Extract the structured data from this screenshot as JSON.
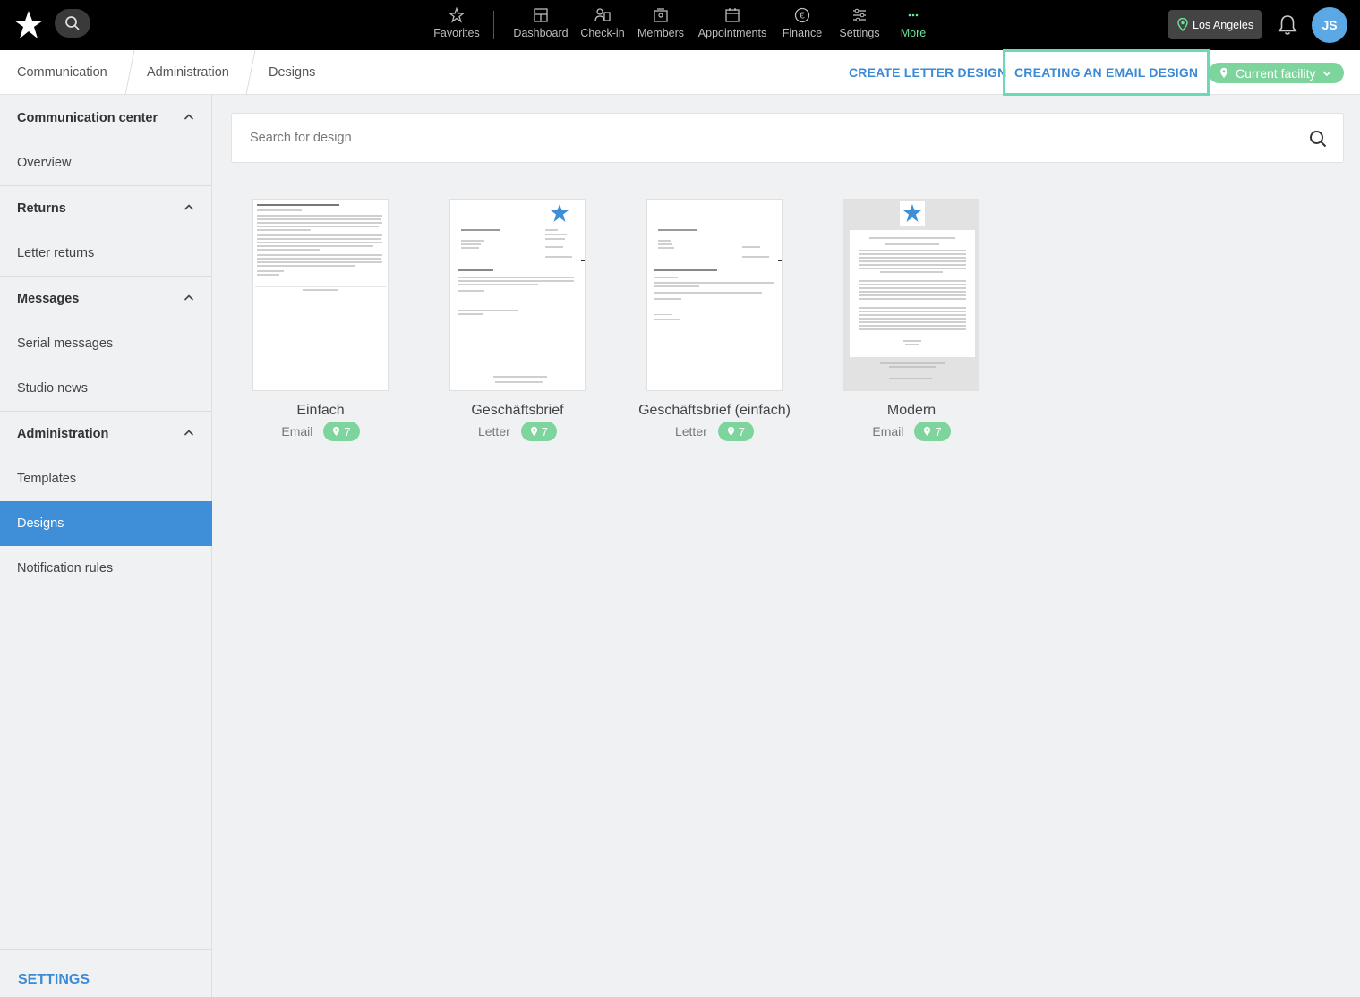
{
  "topbar": {
    "nav": [
      {
        "label": "Favorites",
        "icon": "star-icon"
      },
      {
        "label": "Dashboard",
        "icon": "dashboard-icon"
      },
      {
        "label": "Check-in",
        "icon": "check-in-icon"
      },
      {
        "label": "Members",
        "icon": "members-icon"
      },
      {
        "label": "Appointments",
        "icon": "calendar-icon"
      },
      {
        "label": "Finance",
        "icon": "euro-icon"
      },
      {
        "label": "Settings",
        "icon": "sliders-icon"
      },
      {
        "label": "More",
        "icon": "more-dots-icon"
      }
    ],
    "location": "Los Angeles",
    "avatar_initials": "JS"
  },
  "breadcrumb": {
    "items": [
      "Communication",
      "Administration",
      "Designs"
    ]
  },
  "actions": {
    "create_letter": "CREATE LETTER DESIGN",
    "create_email": "CREATING AN EMAIL DESIGN",
    "facility": "Current facility"
  },
  "sidebar": {
    "sections": [
      {
        "title": "Communication center",
        "items": [
          "Overview"
        ]
      },
      {
        "title": "Returns",
        "items": [
          "Letter returns"
        ]
      },
      {
        "title": "Messages",
        "items": [
          "Serial messages",
          "Studio news"
        ]
      },
      {
        "title": "Administration",
        "items": [
          "Templates",
          "Designs",
          "Notification rules"
        ]
      }
    ],
    "active": "Designs",
    "settings": "SETTINGS"
  },
  "search": {
    "placeholder": "Search for design"
  },
  "designs": [
    {
      "name": "Einfach",
      "type": "Email",
      "count": "7"
    },
    {
      "name": "Geschäftsbrief",
      "type": "Letter",
      "count": "7"
    },
    {
      "name": "Geschäftsbrief (einfach)",
      "type": "Letter",
      "count": "7"
    },
    {
      "name": "Modern",
      "type": "Email",
      "count": "7"
    }
  ],
  "colors": {
    "accent_blue": "#3b8ad6",
    "active_sidebar": "#3f8fd8",
    "badge_green": "#7dd49c",
    "more_green": "#6be39a",
    "highlight_border": "#6bd9b5"
  }
}
